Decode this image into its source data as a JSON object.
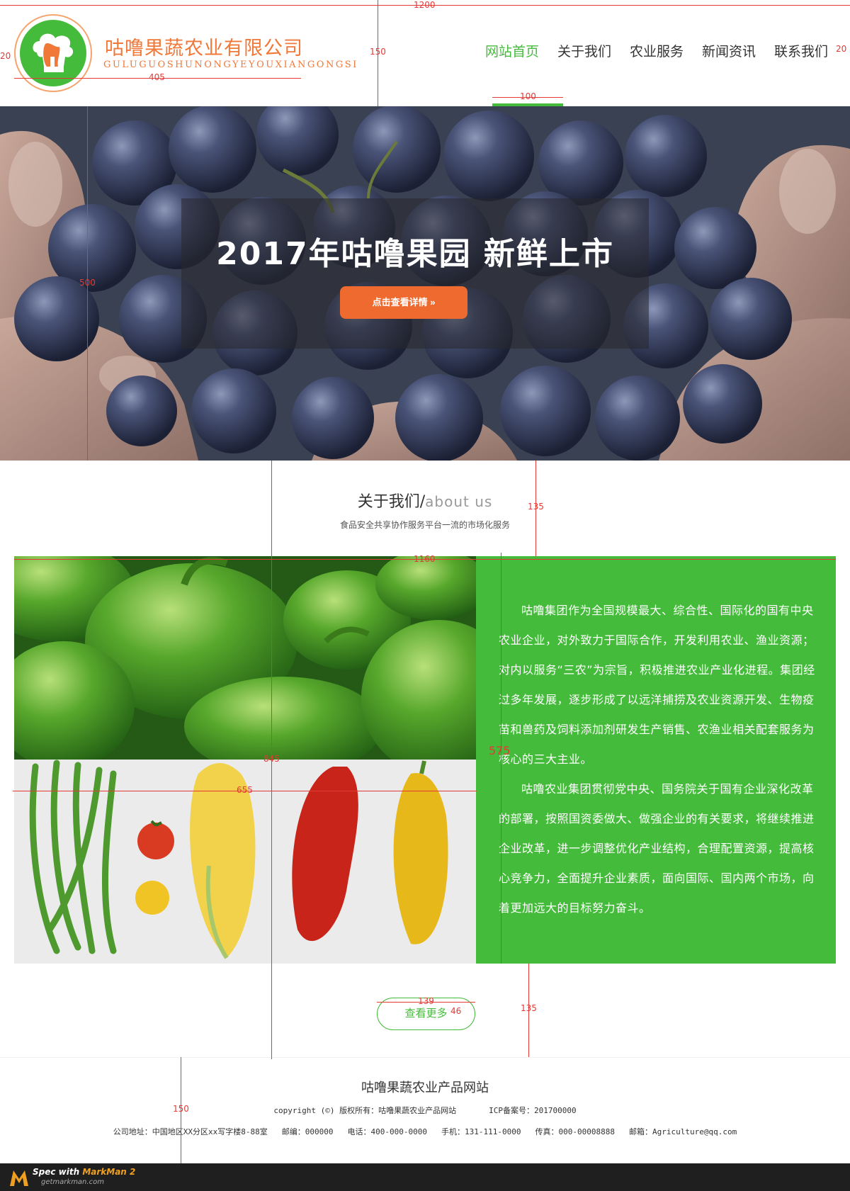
{
  "brand": {
    "name_cn": "咕噜果蔬农业有限公司",
    "name_en": "GULUGUOSHUNONGYEYOUXIANGONGSI",
    "logo_icon": "chef-hat-icon"
  },
  "nav": {
    "items": [
      {
        "label": "网站首页",
        "active": true
      },
      {
        "label": "关于我们",
        "active": false
      },
      {
        "label": "农业服务",
        "active": false
      },
      {
        "label": "新闻资讯",
        "active": false
      },
      {
        "label": "联系我们",
        "active": false
      }
    ]
  },
  "hero": {
    "title": "2017年咕噜果园 新鲜上市",
    "button_label": "点击查看详情 »"
  },
  "about": {
    "title_cn": "关于我们/",
    "title_en": "about us",
    "subtitle": "食品安全共享协作服务平台一流的市场化服务",
    "paragraphs": [
      "咕噜集团作为全国规模最大、综合性、国际化的国有中央农业企业，对外致力于国际合作，开发利用农业、渔业资源；对内以服务“三农”为宗旨，积极推进农业产业化进程。集团经过多年发展，逐步形成了以远洋捕捞及农业资源开发、生物疫苗和兽药及饲料添加剂研发生产销售、农渔业相关配套服务为核心的三大主业。",
      "咕噜农业集团贯彻党中央、国务院关于国有企业深化改革的部署，按照国资委做大、做强企业的有关要求，将继续推进企业改革，进一步调整优化产业结构，合理配置资源，提高核心竞争力，全面提升企业素质，面向国际、国内两个市场，向着更加远大的目标努力奋斗。"
    ],
    "more_label": "查看更多"
  },
  "footer": {
    "title": "咕噜果蔬农业产品网站",
    "copyright": "copyright (©) 版权所有：咕噜果蔬农业产品网站",
    "icp": "ICP备案号：201700000",
    "address": "公司地址：中国地区XX分区xx写字楼8-88室",
    "zip": "邮编：000000",
    "phone": "电话：400-000-0000",
    "mobile": "手机：131-111-0000",
    "fax": "传真：000-00008888",
    "email": "邮箱：Agriculture@qq.com"
  },
  "markman": {
    "spec_prefix": "Spec with ",
    "brand": "MarkMan 2",
    "url": "getmarkman.com"
  },
  "annotations": {
    "page_width": "1200",
    "header_height": "150",
    "logo_left": "20",
    "logo_width": "405",
    "nav_right": "20",
    "nav_underline": "100",
    "hero_height": "500",
    "about_gap_top": "135",
    "content_width": "1160",
    "content_height": "575",
    "total_height": "845",
    "image_width": "655",
    "more_width": "139",
    "more_height": "46",
    "about_gap_bottom": "135",
    "footer_height": "150"
  },
  "colors": {
    "accent_green": "#44bb3a",
    "accent_orange": "#ee6a2e",
    "annotation_red": "#e53935"
  }
}
